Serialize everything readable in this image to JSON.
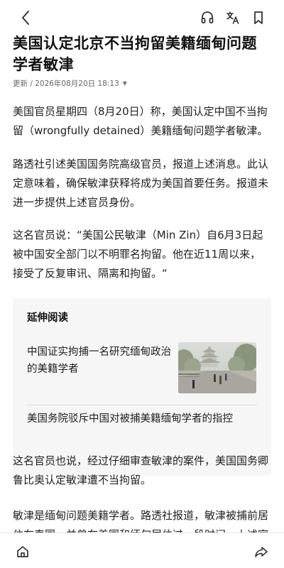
{
  "article": {
    "title": "美国认定北京不当拘留美籍缅甸问题学者敏津",
    "meta": "更新 / 2026年08月20日 18:13",
    "paragraphs": [
      "美国官员星期四（8月20日）称，美国认定中国不当拘留（wrongfully detained）美籍缅甸问题学者敏津。",
      "路透社引述美国国务院高级官员，报道上述消息。此认定意味着，确保敏津获释将成为美国首要任务。报道未进一步提供上述官员身份。",
      "这名官员说：“美国公民敏津（Min Zin）自6月3日起被中国安全部门以不明罪名拘留。他在近11周以来，接受了反复审讯、隔离和拘留。“",
      "这名官员也说，经过仔细审查敏津的案件，美国国务卿鲁比奥认定敏津遭不当拘留。",
      "敏津是缅甸问题美籍学者。路透社报道，敏津被捕前居住在泰国，并曾在美国和缅甸居住过一段时间。上述官"
    ]
  },
  "related": {
    "heading": "延伸阅读",
    "items": [
      "中国证实拘捕一名研究缅甸政治的美籍学者",
      "美国务院驳斥中国对被捕美籍缅甸学者的指控"
    ]
  },
  "icons": {
    "back": "back-arrow-icon",
    "listen": "headphones-icon",
    "translate": "translate-icon",
    "bookmark": "bookmark-icon",
    "home": "home-icon",
    "share": "share-icon"
  },
  "colors": {
    "text": "#222222",
    "muted": "#666666",
    "panel": "#f6f6f6"
  }
}
